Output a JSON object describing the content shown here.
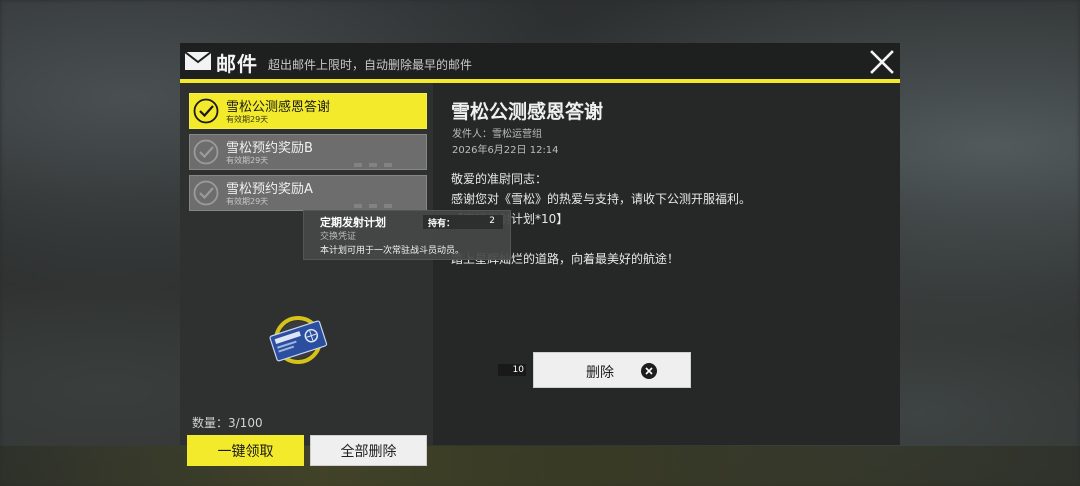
{
  "header": {
    "title": "邮件",
    "subtitle": "超出邮件上限时，自动删除最早的邮件"
  },
  "mail_list": [
    {
      "title": "雪松公测感恩答谢",
      "expiry": "有效期29天",
      "selected": true
    },
    {
      "title": "雪松预约奖励B",
      "expiry": "有效期29天",
      "selected": false
    },
    {
      "title": "雪松预约奖励A",
      "expiry": "有效期29天",
      "selected": false
    }
  ],
  "count_text": "数量：3/100",
  "buttons": {
    "claim_all": "一键领取",
    "delete_all": "全部删除",
    "delete": "删除"
  },
  "mail": {
    "title": "雪松公测感恩答谢",
    "sender": "发件人：雪松运营组",
    "date": "2026年6月22日 12:14",
    "body": [
      "敬爱的准尉同志：",
      "感谢您对《雪松》的热爱与支持，请收下公测开服福利。",
      "【定期发射计划*10】",
      "",
      "踏上星辉灿烂的道路，向着最美好的航途！"
    ],
    "attachment": {
      "icon": "launch-plan-ticket-icon",
      "quantity": "10"
    }
  },
  "tooltip": {
    "name": "定期发射计划",
    "type": "交换凭证",
    "owned_label": "持有：",
    "owned_value": "2",
    "description": "本计划可用于一次常驻战斗员动员。"
  },
  "colors": {
    "accent": "#f2ea2a",
    "panel_dark": "#262727",
    "panel_left": "#2f3131"
  }
}
